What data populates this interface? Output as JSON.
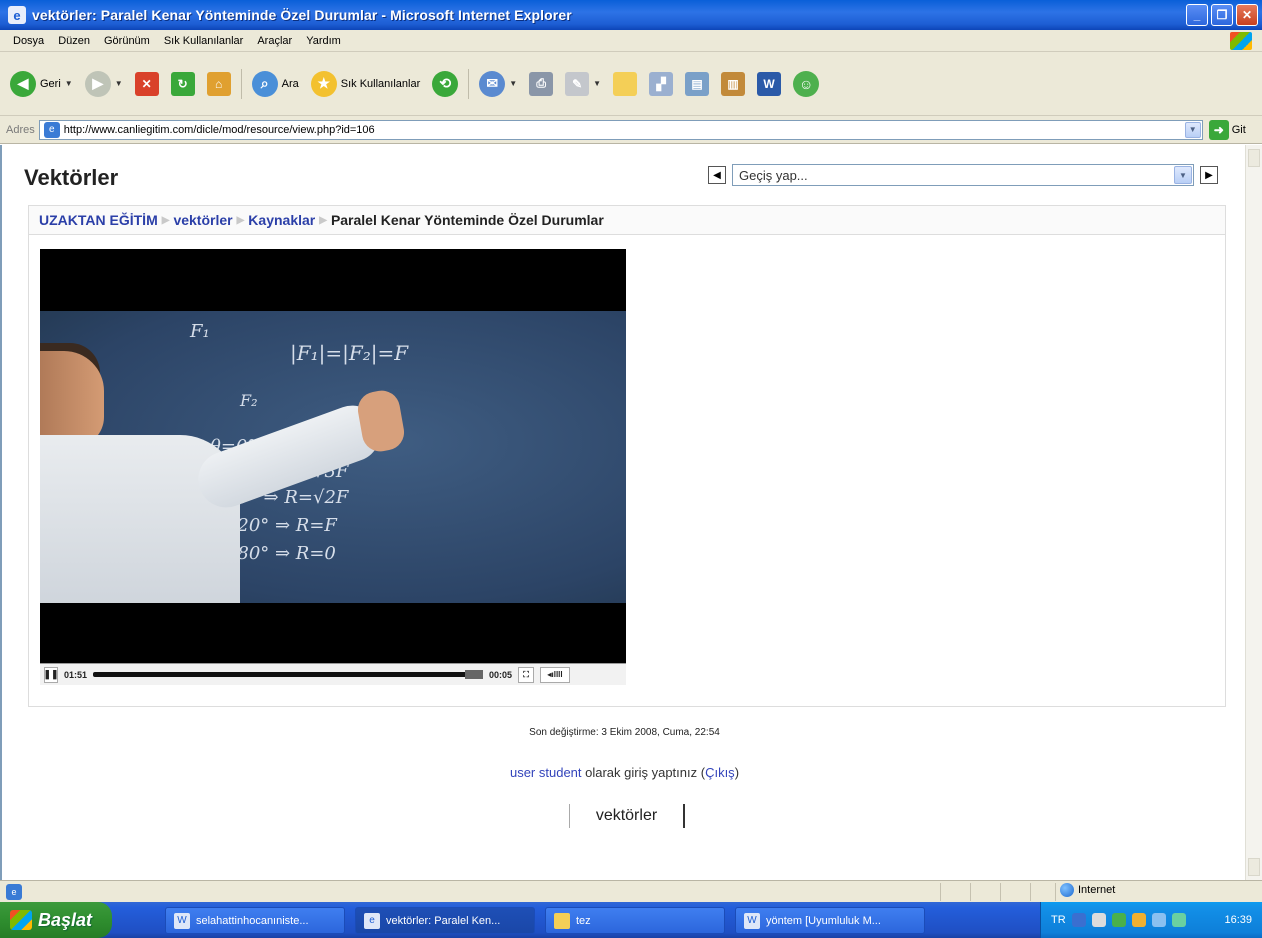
{
  "window": {
    "title": "vektörler: Paralel Kenar Yönteminde Özel Durumlar - Microsoft Internet Explorer"
  },
  "menu": [
    "Dosya",
    "Düzen",
    "Görünüm",
    "Sık Kullanılanlar",
    "Araçlar",
    "Yardım"
  ],
  "toolbar": {
    "back_label": "Geri",
    "search_label": "Ara",
    "favorites_label": "Sık Kullanılanlar"
  },
  "address": {
    "label": "Adres",
    "url": "http://www.canliegitim.com/dicle/mod/resource/view.php?id=106",
    "go_label": "Git"
  },
  "page": {
    "heading": "Vektörler",
    "jump_placeholder": "Geçiş yap...",
    "breadcrumb": {
      "root": "UZAKTAN EĞİTİM",
      "course": "vektörler",
      "section": "Kaynaklar",
      "current": "Paralel Kenar Yönteminde Özel Durumlar"
    },
    "video": {
      "elapsed": "01:51",
      "remaining": "00:05",
      "progress": 0.95
    },
    "modified": "Son değiştirme: 3 Ekim 2008, Cuma, 22:54",
    "login": {
      "user": "user student",
      "middle": " olarak giriş yaptınız (",
      "logout": "Çıkış",
      "end": ")"
    },
    "footer_button": "vektörler"
  },
  "status": {
    "zone": "Internet"
  },
  "taskbar": {
    "start": "Başlat",
    "tasks": [
      "selahattinhocanıniste...",
      "vektörler: Paralel Ken...",
      "tez",
      "yöntem [Uyumluluk M..."
    ],
    "lang": "TR",
    "clock": "16:39"
  }
}
